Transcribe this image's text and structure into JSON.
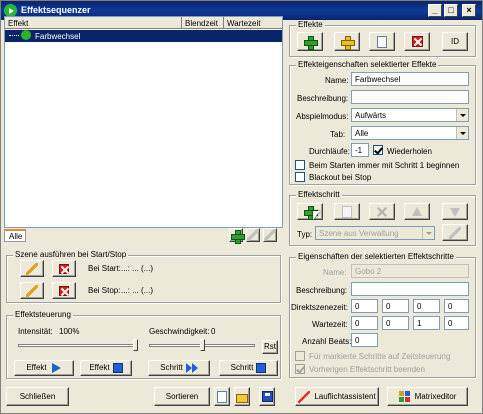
{
  "window": {
    "title": "Effektsequenzer",
    "controls": [
      "_",
      "□",
      "×"
    ]
  },
  "effect_list": {
    "columns": [
      "Effekt",
      "Blendzeit",
      "Wartezeit"
    ],
    "rows": [
      {
        "name": "Farbwechsel",
        "blendzeit": "",
        "wartezeit": ""
      }
    ],
    "tab_label": "Alle"
  },
  "scene_section": {
    "title": "Szene ausführen bei Start/Stop",
    "start_label": "Bei Start:",
    "start_value": "...: ... (...)",
    "stop_label": "Bei Stop:",
    "stop_value": "...: ... (...)"
  },
  "control_section": {
    "title": "Effektsteuerung",
    "intensity_label": "Intensität:",
    "intensity_value": "100%",
    "speed_label": "Geschwindigkeit:",
    "speed_value": "0",
    "reset_label": "Rst",
    "intensity_level": 1.0,
    "speed_level": 0.5,
    "buttons": [
      {
        "label": "Effekt",
        "icon": "play-icon"
      },
      {
        "label": "Effekt",
        "icon": "stop-icon"
      },
      {
        "label": "Schritt",
        "icon": "fast-forward-icon"
      },
      {
        "label": "Schritt",
        "icon": "stop-icon"
      }
    ]
  },
  "footer": {
    "close_label": "Schließen",
    "sort_label": "Sortieren"
  },
  "effects_group": {
    "title": "Effekte",
    "id_label": "ID"
  },
  "properties": {
    "title": "Effekteigenschaften selektierter Effekte",
    "name_label": "Name:",
    "name_value": "Farbwechsel",
    "description_label": "Beschreibung:",
    "description_value": "",
    "playmode_label": "Abspielmodus:",
    "playmode_value": "Aufwärts",
    "tab_label": "Tab:",
    "tab_value": "Alle",
    "runs_label": "Durchläufe:",
    "runs_value": "-1",
    "repeat_label": "Wiederholen",
    "repeat_checked": true,
    "start_step1_label": "Beim Starten immer mit Schritt 1 beginnen",
    "start_step1_checked": false,
    "blackout_label": "Blackout bei Stop",
    "blackout_checked": false
  },
  "step_group": {
    "title": "Effektschritt",
    "type_label": "Typ:",
    "type_value": "Szene aus Verwaltung"
  },
  "step_properties": {
    "title": "Eigenschaften der selektierten Effektschritte",
    "name_label": "Name:",
    "name_value": "Gobo 2",
    "description_label": "Beschreibung:",
    "description_value": "",
    "direct_label": "Direktszenezeit:",
    "direct_values": [
      "0",
      "0",
      "0",
      "0"
    ],
    "wait_label": "Wartezeit:",
    "wait_values": [
      "0",
      "0",
      "1",
      "0"
    ],
    "beats_label": "Anzahl Beats:",
    "beats_value": "0",
    "timecontrol_label": "Für markierte Schritte auf Zeitsteuerung",
    "timecontrol_checked": false,
    "prevstep_label": "Vorherigen Effektschritt beenden",
    "prevstep_checked": true
  },
  "bottom_buttons": {
    "wizard_label": "Lauflichtassistent",
    "matrix_label": "Matrixeditor"
  }
}
